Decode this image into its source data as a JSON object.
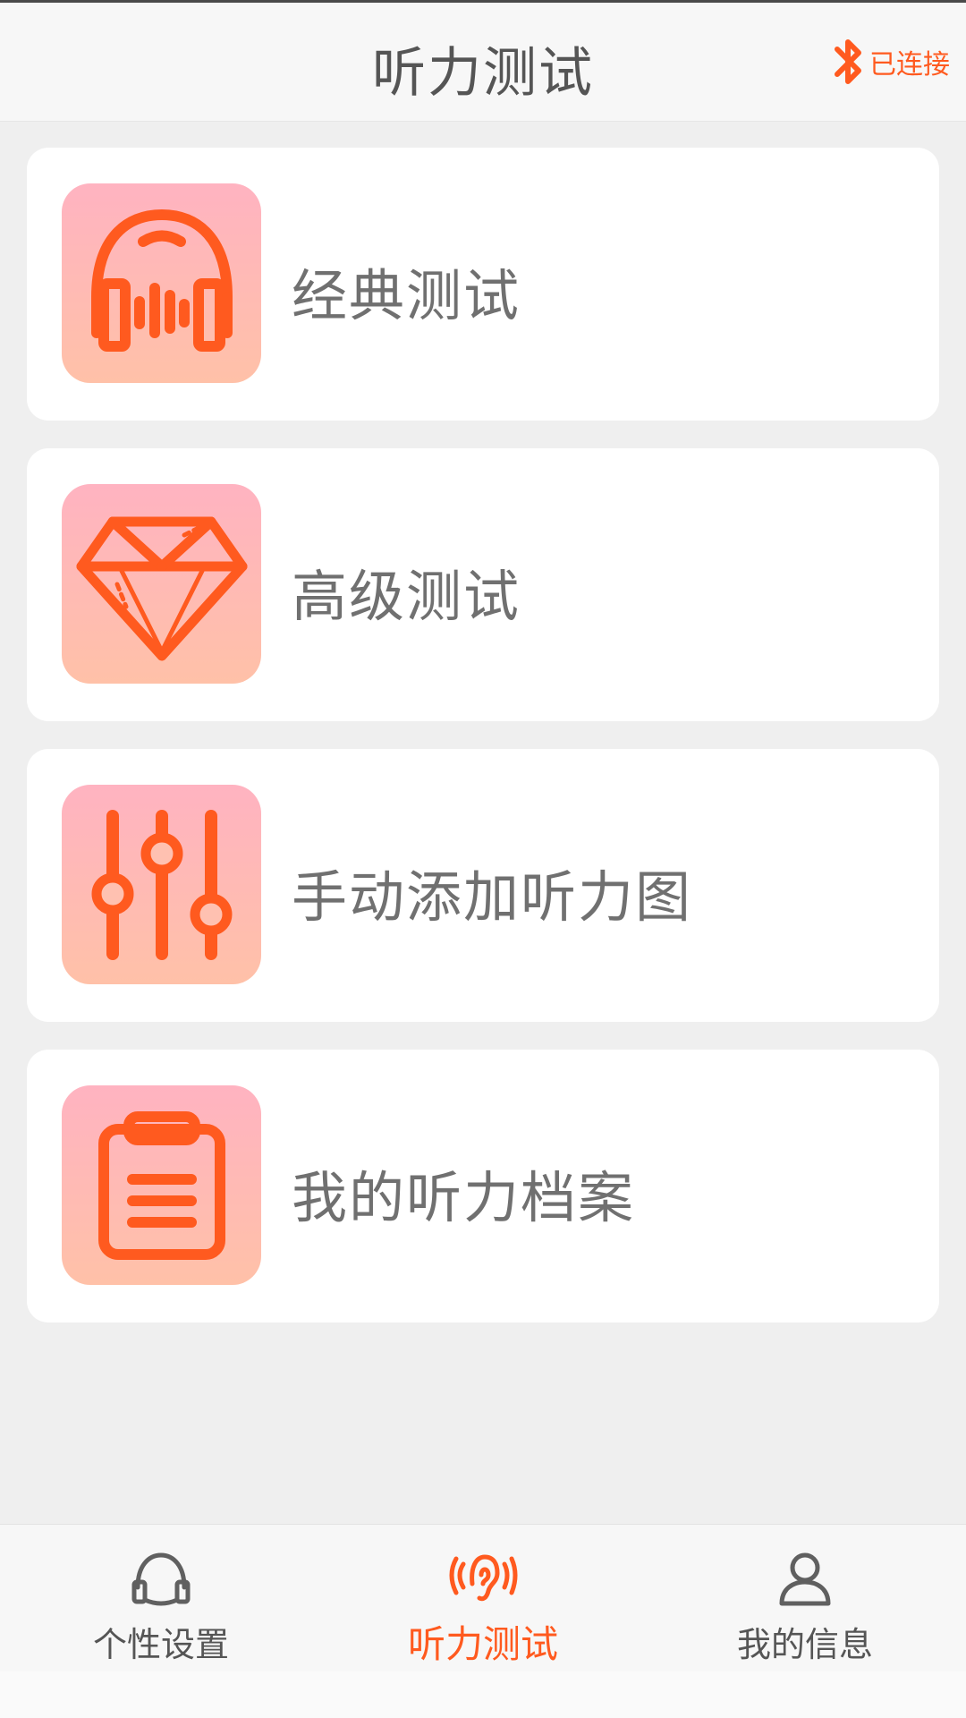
{
  "header": {
    "title": "听力测试",
    "bluetooth_status": "已连接"
  },
  "menu": [
    {
      "label": "经典测试",
      "icon": "headphones-icon"
    },
    {
      "label": "高级测试",
      "icon": "diamond-icon"
    },
    {
      "label": "手动添加听力图",
      "icon": "sliders-icon"
    },
    {
      "label": "我的听力档案",
      "icon": "clipboard-icon"
    }
  ],
  "tabs": [
    {
      "label": "个性设置",
      "icon": "headset-icon",
      "active": false
    },
    {
      "label": "听力测试",
      "icon": "ear-icon",
      "active": true
    },
    {
      "label": "我的信息",
      "icon": "user-icon",
      "active": false
    }
  ],
  "colors": {
    "accent": "#ff5a1f",
    "tile_gradient_top": "#ffb3c1",
    "tile_gradient_bottom": "#ffc1a8",
    "text_gray": "#707070"
  }
}
